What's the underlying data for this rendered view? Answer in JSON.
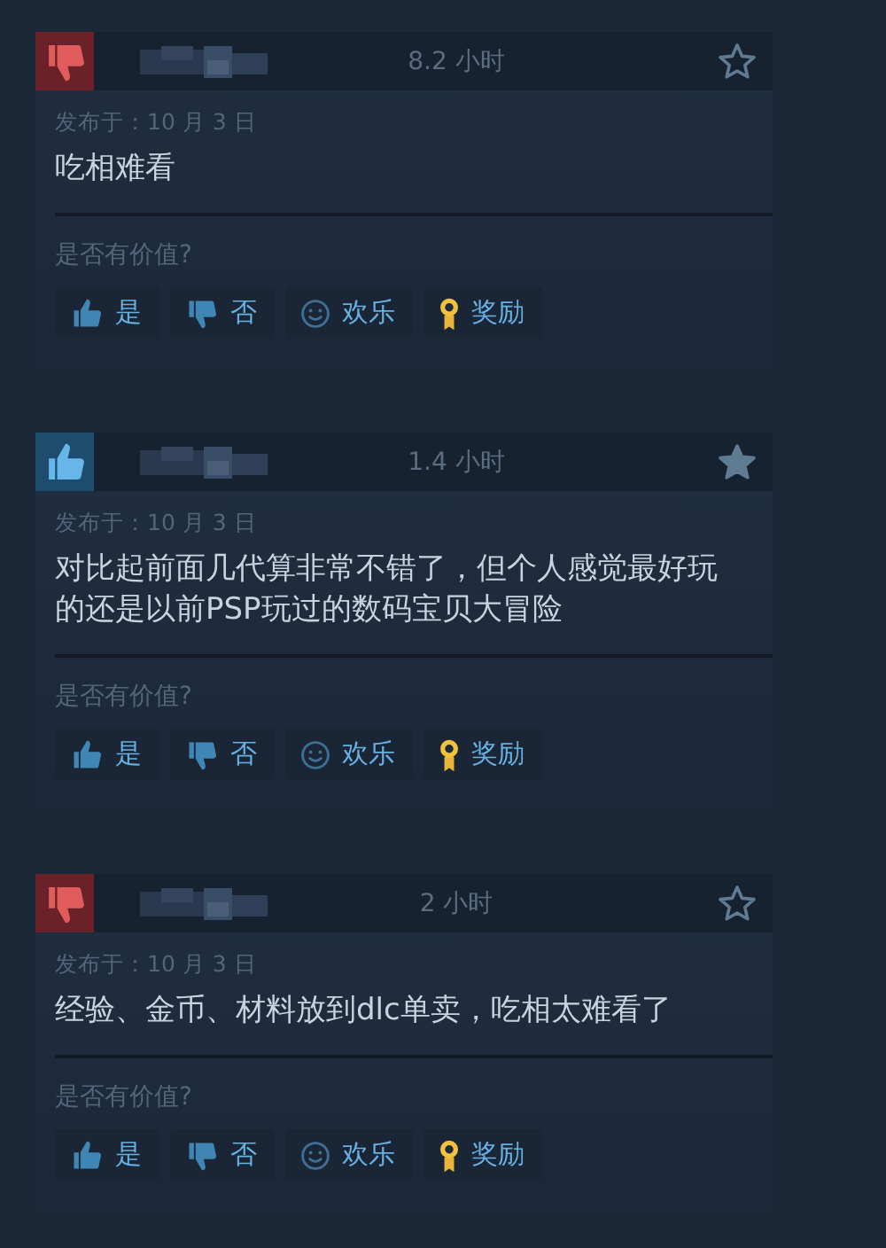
{
  "reviews": [
    {
      "recommended": false,
      "hours": "8.2 小时",
      "starred": false,
      "posted": "发布于：10 月 3 日",
      "body": "吃相难看",
      "helpful_prompt": "是否有价值?",
      "buttons": [
        {
          "kind": "yes",
          "label": "是"
        },
        {
          "kind": "no",
          "label": "否"
        },
        {
          "kind": "funny",
          "label": "欢乐"
        },
        {
          "kind": "award",
          "label": "奖励"
        }
      ]
    },
    {
      "recommended": true,
      "hours": "1.4 小时",
      "starred": true,
      "posted": "发布于：10 月 3 日",
      "body": "对比起前面几代算非常不错了，但个人感觉最好玩的还是以前PSP玩过的数码宝贝大冒险",
      "helpful_prompt": "是否有价值?",
      "buttons": [
        {
          "kind": "yes",
          "label": "是"
        },
        {
          "kind": "no",
          "label": "否"
        },
        {
          "kind": "funny",
          "label": "欢乐"
        },
        {
          "kind": "award",
          "label": "奖励"
        }
      ]
    },
    {
      "recommended": false,
      "hours": "2 小时",
      "starred": false,
      "posted": "发布于：10 月 3 日",
      "body": "经验、金币、材料放到dlc单卖，吃相太难看了",
      "helpful_prompt": "是否有价值?",
      "buttons": [
        {
          "kind": "yes",
          "label": "是"
        },
        {
          "kind": "no",
          "label": "否"
        },
        {
          "kind": "funny",
          "label": "欢乐"
        },
        {
          "kind": "award",
          "label": "奖励"
        }
      ]
    }
  ]
}
